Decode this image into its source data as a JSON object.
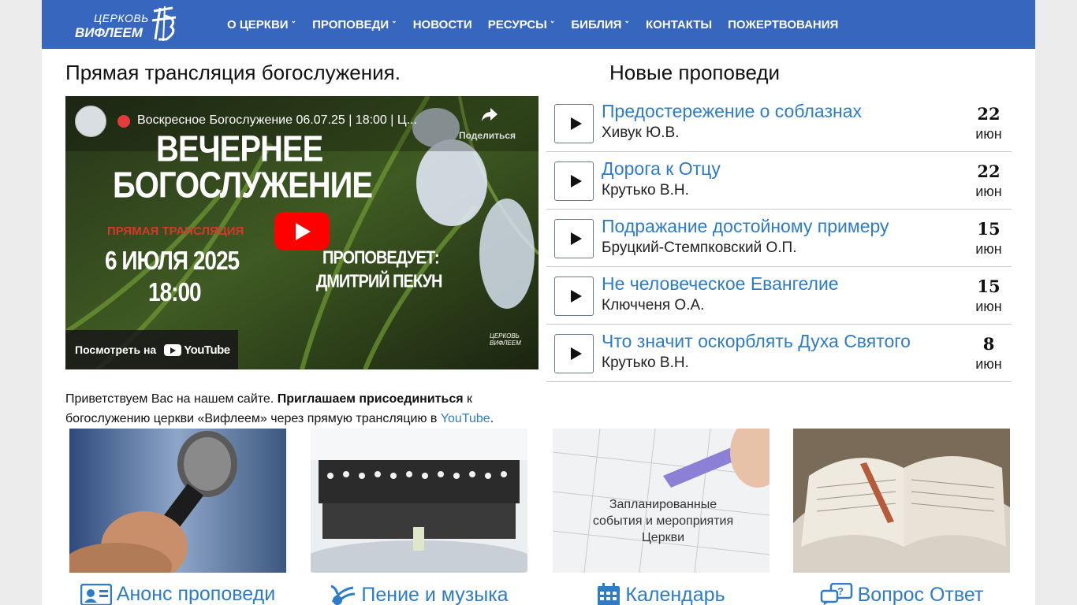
{
  "header": {
    "logo": {
      "line1": "ЦЕРКОВЬ",
      "line2": "ВИФЛЕЕМ"
    },
    "nav": [
      {
        "label": "О ЦЕРКВИ",
        "dropdown": true
      },
      {
        "label": "ПРОПОВЕДИ",
        "dropdown": true
      },
      {
        "label": "НОВОСТИ",
        "dropdown": false
      },
      {
        "label": "РЕСУРСЫ",
        "dropdown": true
      },
      {
        "label": "БИБЛИЯ",
        "dropdown": true
      },
      {
        "label": "КОНТАКТЫ",
        "dropdown": false
      },
      {
        "label": "ПОЖЕРТВОВАНИЯ",
        "dropdown": false
      }
    ],
    "bg_color": "#3766bf"
  },
  "live": {
    "heading": "Прямая трансляция богослужения.",
    "video": {
      "title": "Воскресное Богослужение 06.07.25 | 18:00 | Ц...",
      "share_label": "Поделиться",
      "poster": {
        "line1": "ВЕЧЕРНЕЕ",
        "line2": "БОГОСЛУЖЕНИЕ",
        "live_label": "ПРЯМАЯ ТРАНСЛЯЦИЯ",
        "date": "6 ИЮЛЯ 2025",
        "time": "18:00",
        "preacher_label": "ПРОПОВЕДУЕТ:",
        "preacher_name": "ДМИТРИЙ ПЕКУН",
        "logo_line1": "ЦЕРКОВЬ",
        "logo_line2": "ВИФЛЕЕМ"
      },
      "watch_on": "Посмотреть на",
      "youtube": "YouTube"
    },
    "welcome": {
      "part1": "Приветствуем Вас на нашем сайте. ",
      "bold": "Приглашаем присоединиться",
      "part2": " к богослужению церкви «Вифлеем» через прямую трансляцию в ",
      "link": "YouTube",
      "part3": "."
    }
  },
  "sermons": {
    "heading": "Новые проповеди",
    "items": [
      {
        "title": "Предостережение о соблазнах",
        "author": "Хивук Ю.В.",
        "day": "22",
        "month": "июн"
      },
      {
        "title": "Дорога к Отцу",
        "author": "Крутько В.Н.",
        "day": "22",
        "month": "июн"
      },
      {
        "title": "Подражание достойному примеру",
        "author": "Бруцкий-Стемпковский О.П.",
        "day": "15",
        "month": "июн"
      },
      {
        "title": "Не человеческое Евангелие",
        "author": "Ключченя О.А.",
        "day": "15",
        "month": "июн"
      },
      {
        "title": "Что значит оскорблять Духа Святого",
        "author": "Крутько В.Н.",
        "day": "8",
        "month": "июн"
      }
    ]
  },
  "cards": [
    {
      "label": "Анонс проповеди",
      "icon": "id-card-icon"
    },
    {
      "label": "Пение и музыка",
      "icon": "music-icon"
    },
    {
      "label": "Календарь",
      "icon": "calendar-icon",
      "image_text": [
        "Запланированные",
        "события и мероприятия",
        "Церкви"
      ]
    },
    {
      "label": "Вопрос Ответ",
      "icon": "chat-question-icon"
    }
  ],
  "colors": {
    "link": "#2e7cc6",
    "accent_red": "#ff0000"
  }
}
